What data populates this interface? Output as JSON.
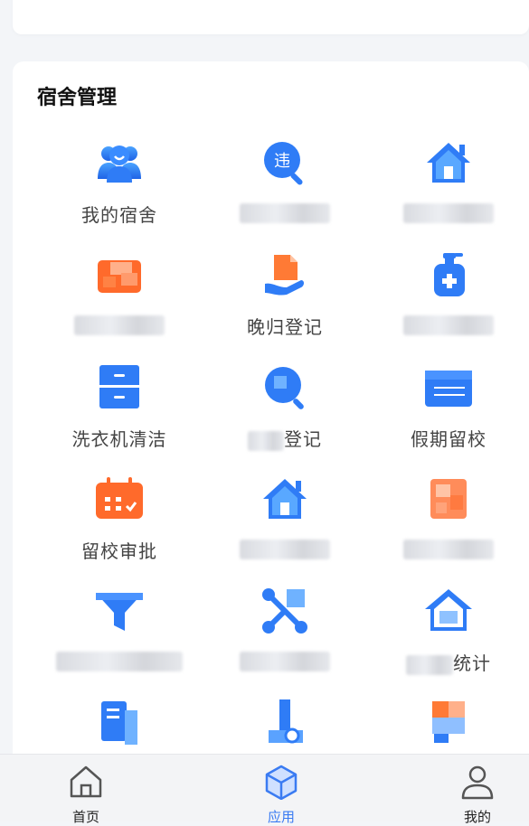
{
  "section": {
    "title": "宿舍管理"
  },
  "tiles": [
    {
      "label": "我的宿舍",
      "icon": "people-icon"
    },
    {
      "label": "",
      "icon": "violation-search-icon"
    },
    {
      "label": "",
      "icon": "home-icon"
    },
    {
      "label": "",
      "icon": "folder-icon"
    },
    {
      "label": "晚归登记",
      "icon": "hand-document-icon"
    },
    {
      "label": "",
      "icon": "sanitizer-icon"
    },
    {
      "label": "洗衣机清洁",
      "icon": "cabinet-icon"
    },
    {
      "label": "登记",
      "icon": "search-register-icon"
    },
    {
      "label": "假期留校",
      "icon": "calendar-board-icon"
    },
    {
      "label": "留校审批",
      "icon": "calendar-check-icon"
    },
    {
      "label": "",
      "icon": "home-icon"
    },
    {
      "label": "",
      "icon": "document-icon"
    },
    {
      "label": "",
      "icon": "funnel-icon"
    },
    {
      "label": "",
      "icon": "network-icon"
    },
    {
      "label": "统计",
      "icon": "home-stats-icon"
    },
    {
      "label": "",
      "icon": "report-icon"
    },
    {
      "label": "",
      "icon": "chart-user-icon"
    },
    {
      "label": "",
      "icon": "chat-icon"
    }
  ],
  "tabbar": {
    "home_label": "首页",
    "apps_label": "应用",
    "mine_label": "我的"
  },
  "colors": {
    "blue": "#2f7cf6",
    "orange": "#ff6a2b",
    "active_tab": "#3a7bf2"
  }
}
